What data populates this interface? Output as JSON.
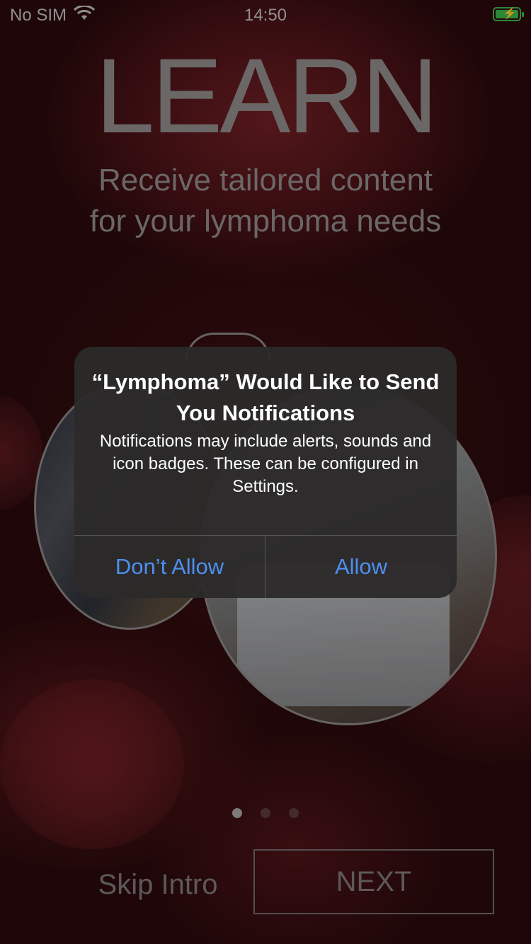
{
  "status_bar": {
    "carrier": "No SIM",
    "time": "14:50",
    "wifi_icon": "wifi-icon",
    "battery_icon": "battery-charging-icon",
    "battery_color": "#3bb54a"
  },
  "intro": {
    "title": "LEARN",
    "subtitle_line1": "Receive tailored content",
    "subtitle_line2": "for your lymphoma needs",
    "page_count": 3,
    "active_page": 1,
    "skip_label": "Skip Intro",
    "next_label": "NEXT"
  },
  "alert": {
    "title": "“Lymphoma” Would Like to Send You Notifications",
    "message": "Notifications may include alerts, sounds and icon badges. These can be configured in Settings.",
    "deny_label": "Don’t Allow",
    "allow_label": "Allow",
    "button_color": "#4d8ff0"
  }
}
